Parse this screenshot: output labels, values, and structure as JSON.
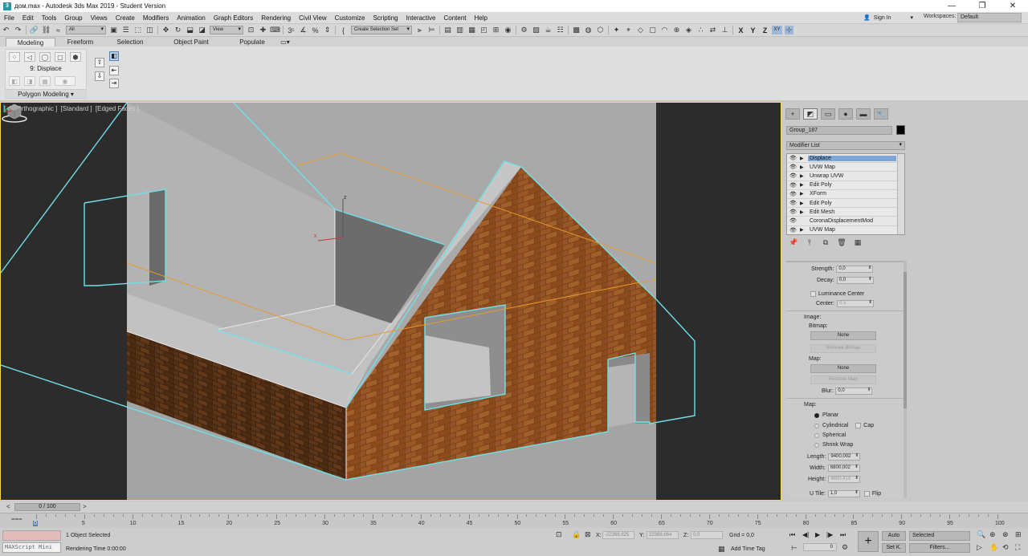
{
  "window": {
    "title": "дом.max - Autodesk 3ds Max 2019 - Student Version",
    "app_icon_letter": "3",
    "controls": [
      "—",
      "❐",
      "✕"
    ]
  },
  "menu": {
    "items": [
      "File",
      "Edit",
      "Tools",
      "Group",
      "Views",
      "Create",
      "Modifiers",
      "Animation",
      "Graph Editors",
      "Rendering",
      "Civil View",
      "Customize",
      "Scripting",
      "Interactive",
      "Content",
      "Help"
    ],
    "sign_in": "Sign In",
    "workspaces_label": "Workspaces:",
    "workspaces_value": "Default"
  },
  "toolbar": {
    "selection_filter": "All",
    "ref_coord": "View",
    "selection_set": "Create Selection Set",
    "axes": [
      "X",
      "Y",
      "Z"
    ],
    "plane": "XY"
  },
  "ribbon": {
    "tabs": [
      "Modeling",
      "Freeform",
      "Selection",
      "Object Paint",
      "Populate"
    ],
    "active_tab": "Modeling",
    "modifier_label": "9: Displace",
    "panel_footer": "Polygon Modeling ▾"
  },
  "viewport": {
    "label_parts": [
      "[+]",
      "[Orthographic ]",
      "[Standard ]",
      "[Edged Faces ]"
    ],
    "gizmo_x": "x",
    "gizmo_z": "z",
    "accent_color": "#6fe0e8",
    "orange_color": "#e89a2c",
    "border_color": "#ffd94a"
  },
  "command_panel": {
    "tabs": [
      "+",
      "◩",
      "▭",
      "●",
      "▬",
      "🔧"
    ],
    "object_name": "Group_187",
    "modifier_list": "Modifier List",
    "stack": [
      {
        "name": "Displace",
        "selected": true
      },
      {
        "name": "UVW Map",
        "selected": false
      },
      {
        "name": "Unwrap UVW",
        "selected": false
      },
      {
        "name": "Edit Poly",
        "selected": false
      },
      {
        "name": "XForm",
        "selected": false
      },
      {
        "name": "Edit Poly",
        "selected": false
      },
      {
        "name": "Edit Mesh",
        "selected": false
      },
      {
        "name": "CoronaDisplacementMod",
        "selected": false
      },
      {
        "name": "UVW Map",
        "selected": false
      }
    ],
    "params": {
      "strength_label": "Strength:",
      "strength_value": "0,0",
      "decay_label": "Decay:",
      "decay_value": "0,0",
      "luminance_label": "Luminance Center",
      "center_label": "Center:",
      "center_value": "0,5",
      "image_title": "Image:",
      "bitmap_label": "Bitmap:",
      "bitmap_button": "None",
      "remove_bitmap": "Remove Bitmap",
      "map_label": "Map:",
      "map_button": "None",
      "remove_map": "Remove Map",
      "blur_label": "Blur:",
      "blur_value": "0,0",
      "map_title": "Map:",
      "planar": "Planar",
      "cylindrical": "Cylindrical",
      "cap": "Cap",
      "spherical": "Spherical",
      "shrink_wrap": "Shrink Wrap",
      "length_label": "Length:",
      "length_value": "9400,002",
      "width_label": "Width:",
      "width_value": "6800,002",
      "height_label": "Height:",
      "height_value": "4600,419",
      "utile_label": "U Tile:",
      "utile_value": "1,0",
      "flip_label": "Flip"
    }
  },
  "timeline": {
    "frame": "0 / 100",
    "ticks": [
      "0",
      "5",
      "10",
      "15",
      "20",
      "25",
      "30",
      "35",
      "40",
      "45",
      "50",
      "55",
      "60",
      "65",
      "70",
      "75",
      "80",
      "85",
      "90",
      "95",
      "100"
    ]
  },
  "status": {
    "maxscript": "MAXScript Mini",
    "selected": "1 Object Selected",
    "render_time": "Rendering Time  0:00:00",
    "x_label": "X:",
    "x_value": "-22366,625",
    "y_label": "Y:",
    "y_value": "22366,664",
    "z_label": "Z:",
    "z_value": "0,0",
    "grid": "Grid = 0,0",
    "add_time_tag": "Add Time Tag",
    "auto": "Auto",
    "set_key": "Set K.",
    "selected_dropdown": "Selected",
    "filters": "Filters...",
    "current_frame": "0"
  }
}
